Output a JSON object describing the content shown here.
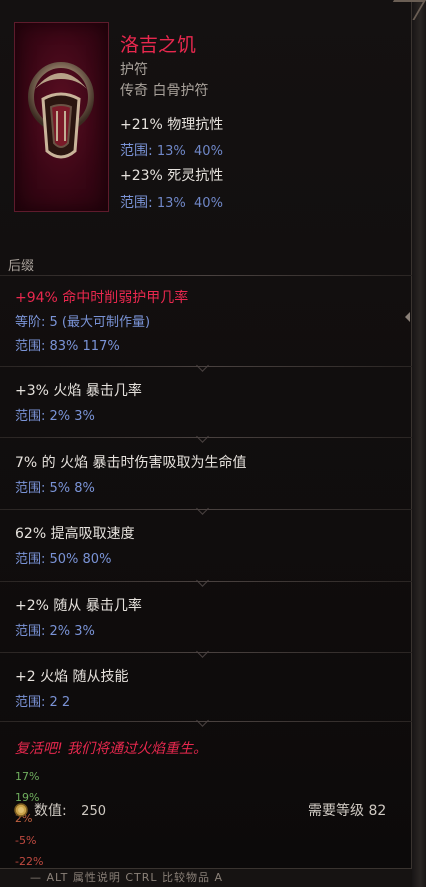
{
  "item": {
    "name": "洛吉之饥",
    "subtype": "护符",
    "rarity_line": "传奇 白骨护符",
    "icon": "bone-amulet-icon"
  },
  "implicits": [
    {
      "text": "+21% 物理抗性",
      "range_label": "范围:",
      "range_a": "13%",
      "range_b": "40%"
    },
    {
      "text": "+23% 死灵抗性",
      "range_label": "范围:",
      "range_a": "13%",
      "range_b": "40%"
    }
  ],
  "section_label": "后缀",
  "affixes": [
    {
      "text": "+94% 命中时削弱护甲几率",
      "tier_line": "等阶: 5  (最大可制作量)",
      "range_line": "范围: 83%  117%"
    },
    {
      "text": "+3% 火焰 暴击几率",
      "range_line": "范围: 2%  3%"
    },
    {
      "text": "7% 的 火焰 暴击时伤害吸取为生命值",
      "range_line": "范围: 5%  8%"
    },
    {
      "text": "62% 提高吸取速度",
      "range_line": "范围: 50%  80%"
    },
    {
      "text": "+2% 随从 暴击几率",
      "range_line": "范围: 2%  3%"
    },
    {
      "text": "+2 火焰 随从技能",
      "range_line": "范围: 2  2"
    }
  ],
  "flavor": "复活吧! 我们将通过火焰重生。",
  "side_numbers": [
    "17%",
    "19%",
    "2%",
    "-5%",
    "-22%"
  ],
  "footer": {
    "value_label": "数值:",
    "value": "250",
    "requirement": "需要等级 82",
    "bottom_text": "— ALT 属性说明          CTRL 比较物品    A"
  },
  "colors": {
    "legendary_red": "#e8284e",
    "range_blue": "#7a93d6",
    "text_white": "#e6e2dd"
  }
}
